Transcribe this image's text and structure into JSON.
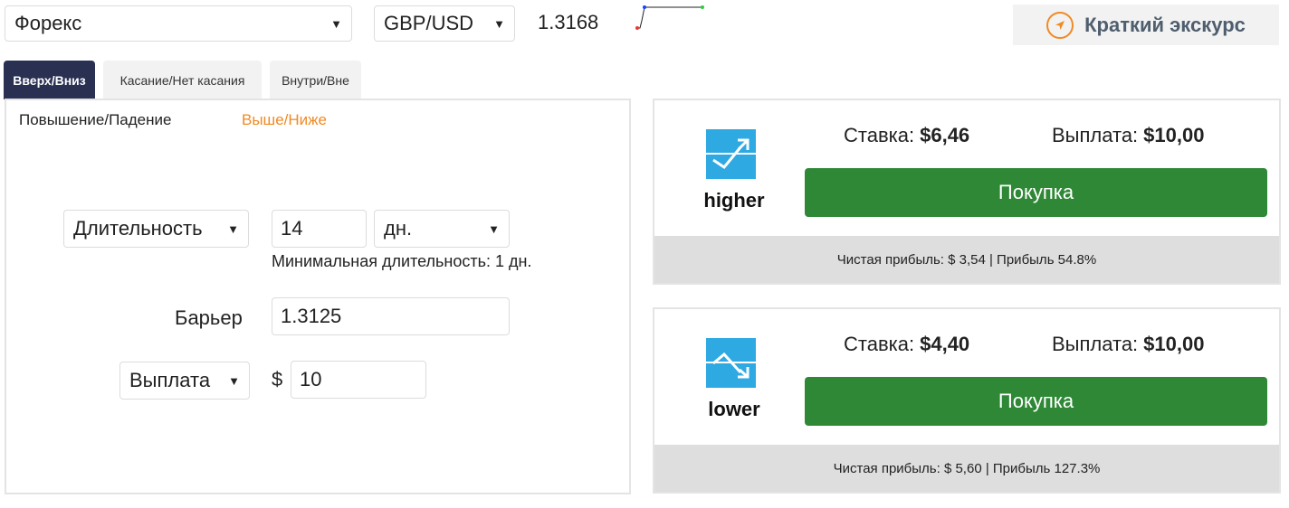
{
  "top": {
    "market": "Форекс",
    "symbol": "GBP/USD",
    "spot": "1.3168",
    "tour_label": "Краткий экскурс"
  },
  "tabs": [
    {
      "label": "Вверх/Вниз",
      "active": true
    },
    {
      "label": "Касание/Нет касания",
      "active": false
    },
    {
      "label": "Внутри/Вне",
      "active": false
    }
  ],
  "subtabs": [
    {
      "label": "Повышение/Падение",
      "active": false
    },
    {
      "label": "Выше/Ниже",
      "active": true
    }
  ],
  "form": {
    "duration_type": "Длительность",
    "duration_value": "14",
    "duration_unit": "дн.",
    "min_duration": "Минимальная длительность: 1 дн.",
    "barrier_label": "Барьер",
    "barrier_value": "1.3125",
    "amount_type": "Выплата",
    "currency_symbol": "$",
    "amount_value": "10"
  },
  "contracts": [
    {
      "type": "higher",
      "stake_label": "Ставка:",
      "stake": "$6,46",
      "payout_label": "Выплата:",
      "payout": "$10,00",
      "buy_label": "Покупка",
      "footer": "Чистая прибыль: $ 3,54 | Прибыль 54.8%"
    },
    {
      "type": "lower",
      "stake_label": "Ставка:",
      "stake": "$4,40",
      "payout_label": "Выплата:",
      "payout": "$10,00",
      "buy_label": "Покупка",
      "footer": "Чистая прибыль: $ 5,60 | Прибыль 127.3%"
    }
  ],
  "colors": {
    "active_tab": "#2a3052",
    "accent": "#f08a24",
    "buy": "#2e8836",
    "contract_icon": "#2fa9e2"
  }
}
